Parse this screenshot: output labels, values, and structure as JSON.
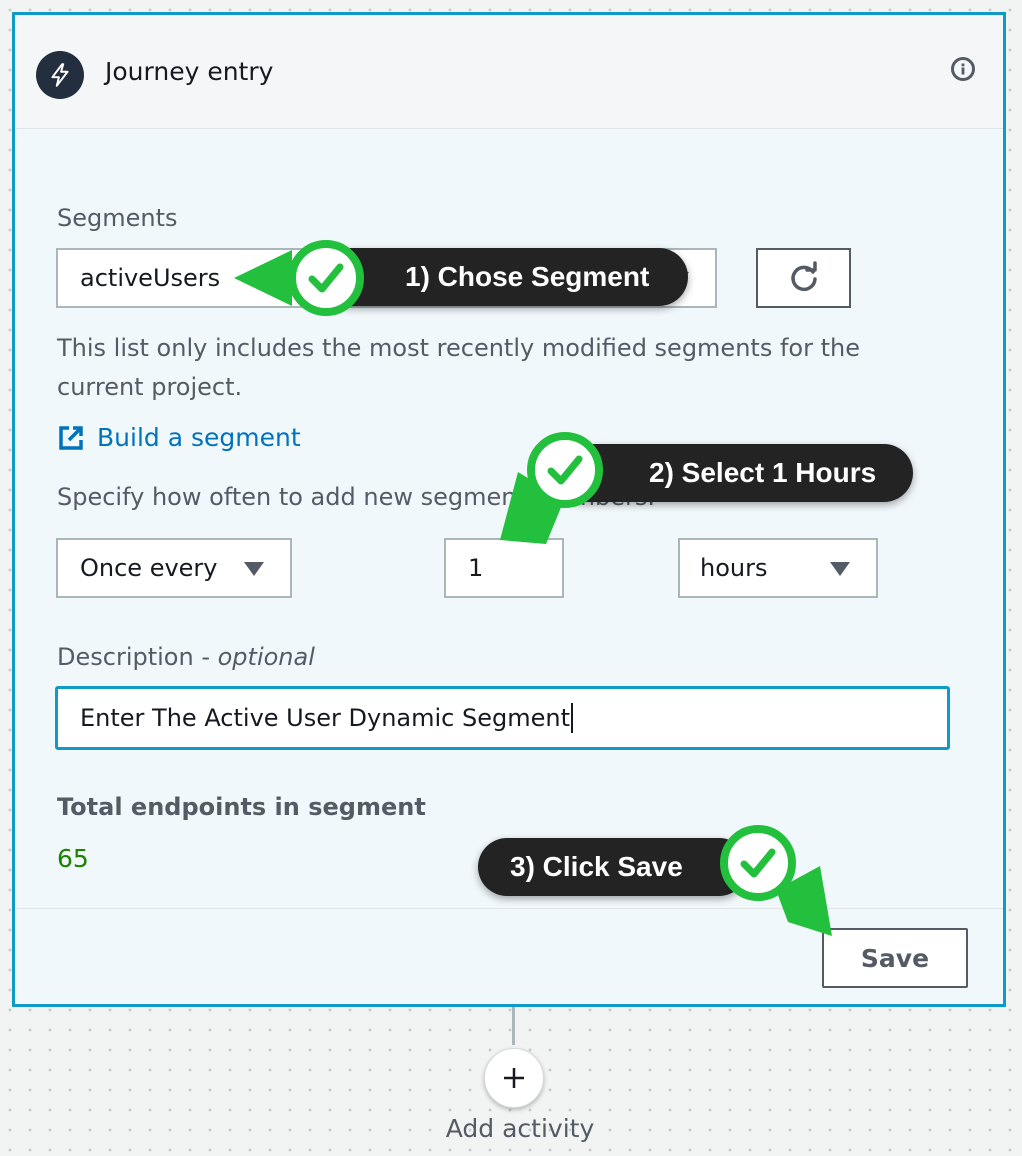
{
  "panel": {
    "title": "Journey entry",
    "segments_label": "Segments",
    "segment_value": "activeUsers",
    "segment_help": "This list only includes the most recently modified segments for the current project.",
    "build_link": "Build a segment",
    "frequency_label": "Specify how often to add new segment members.",
    "frequency_option": "Once every",
    "interval_value": "1",
    "unit_option": "hours",
    "description_label": "Description - ",
    "description_optional": "optional",
    "description_value": "Enter The Active User Dynamic Segment",
    "total_label": "Total endpoints in segment",
    "total_value": "65",
    "save_label": "Save"
  },
  "canvas": {
    "add_activity_label": "Add activity"
  },
  "callouts": {
    "step1": "1) Chose Segment",
    "step2": "2) Select 1 Hours",
    "step3": "3) Click Save"
  },
  "colors": {
    "accent": "#0f9bc5",
    "link": "#0073bb",
    "success": "#1d8102",
    "callout_green": "#22c03c",
    "callout_dark": "#232323"
  },
  "icons": {
    "trigger": "lightning-bolt-icon",
    "info": "info-icon",
    "refresh": "refresh-icon",
    "external": "external-link-icon",
    "add": "plus-icon",
    "check": "checkmark-icon"
  }
}
